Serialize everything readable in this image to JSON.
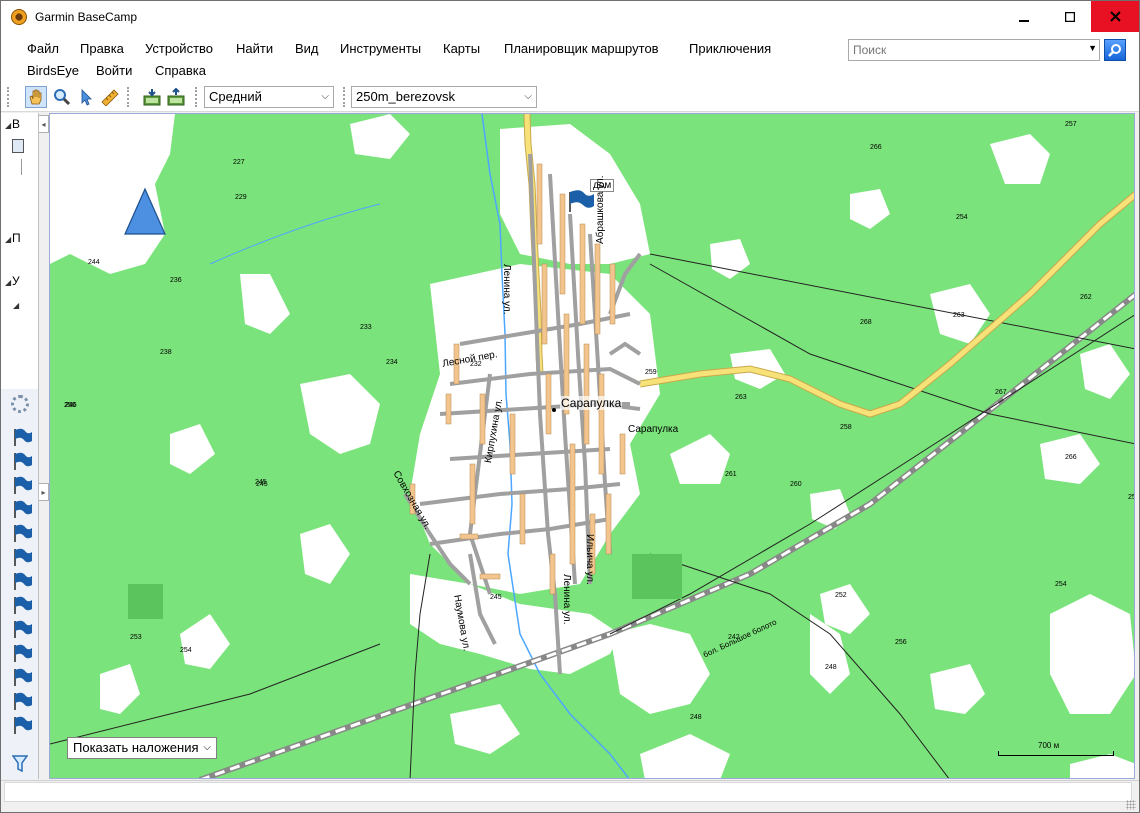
{
  "window": {
    "title": "Garmin BaseCamp"
  },
  "menu": {
    "items": [
      "Файл",
      "Правка",
      "Устройство",
      "Найти",
      "Вид",
      "Инструменты",
      "Карты",
      "Планировщик маршрутов",
      "Приключения",
      "BirdsEye",
      "Войти",
      "Справка"
    ]
  },
  "search": {
    "placeholder": "Поиск"
  },
  "toolbar": {
    "detail_select": "Средний",
    "map_select": "250m_berezovsk"
  },
  "left_tree": {
    "letters": [
      "В",
      "П",
      "У"
    ]
  },
  "map": {
    "overlay_select": "Показать наложения",
    "scale_label": "700 м",
    "waypoint_label": "дом",
    "town_label": "Сарапулка",
    "town_label_small": "Сарапулка",
    "streets": [
      "Ленина ул.",
      "Абрашкова ул.",
      "Лесной пер.",
      "Кирпухина ул.",
      "Совхозная ул.",
      "Наумова ул.",
      "Ленина ул.",
      "Ильича ул."
    ],
    "heights": [
      "227",
      "229",
      "244",
      "236",
      "238",
      "233",
      "234",
      "232",
      "250",
      "245",
      "253",
      "254",
      "259",
      "263",
      "266",
      "257",
      "254",
      "262",
      "268",
      "263",
      "267",
      "266",
      "261",
      "260",
      "258",
      "250",
      "252",
      "256",
      "254",
      "248",
      "242",
      "248",
      "245",
      "245",
      "246"
    ],
    "swamp_label": "бол. Большое болото"
  },
  "colors": {
    "forest": "#7be37b",
    "road_main": "#f7e27a",
    "road_outline": "#c9a84a",
    "street": "#b0b0b0",
    "building": "#f3c58e",
    "water": "#4da6ff",
    "flag": "#1a5fa8",
    "close_button": "#e81123"
  }
}
